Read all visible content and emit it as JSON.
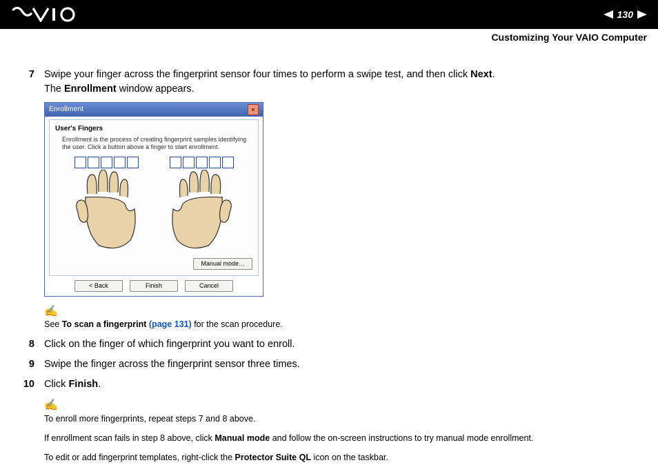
{
  "header": {
    "page_number": "130",
    "section": "Customizing Your VAIO Computer"
  },
  "steps": {
    "s7": {
      "num": "7",
      "line1_a": "Swipe your finger across the fingerprint sensor four times to perform a swipe test, and then click ",
      "line1_b": "Next",
      "line1_c": ".",
      "line2_a": "The ",
      "line2_b": "Enrollment",
      "line2_c": " window appears."
    },
    "s8": {
      "num": "8",
      "text": "Click on the finger of which fingerprint you want to enroll."
    },
    "s9": {
      "num": "9",
      "text": "Swipe the finger across the fingerprint sensor three times."
    },
    "s10": {
      "num": "10",
      "text_a": "Click ",
      "text_b": "Finish",
      "text_c": "."
    }
  },
  "dialog": {
    "title": "Enrollment",
    "heading": "User's Fingers",
    "subtext": "Enrollment is the process of creating fingerprint samples identifying the user. Click a button above a finger to start enrollment.",
    "manual_btn": "Manual mode…",
    "back_btn": "< Back",
    "finish_btn": "Finish",
    "cancel_btn": "Cancel"
  },
  "note1": {
    "a": "See ",
    "b": "To scan a fingerprint ",
    "link": "(page 131)",
    "c": " for the scan procedure."
  },
  "note2": {
    "l1": "To enroll more fingerprints, repeat steps 7 and 8 above.",
    "l2_a": "If enrollment scan fails in step 8 above, click ",
    "l2_b": "Manual mode",
    "l2_c": " and follow the on-screen instructions to try manual mode enrollment.",
    "l3_a": "To edit or add fingerprint templates, right-click the ",
    "l3_b": "Protector Suite QL",
    "l3_c": " icon on the taskbar."
  }
}
